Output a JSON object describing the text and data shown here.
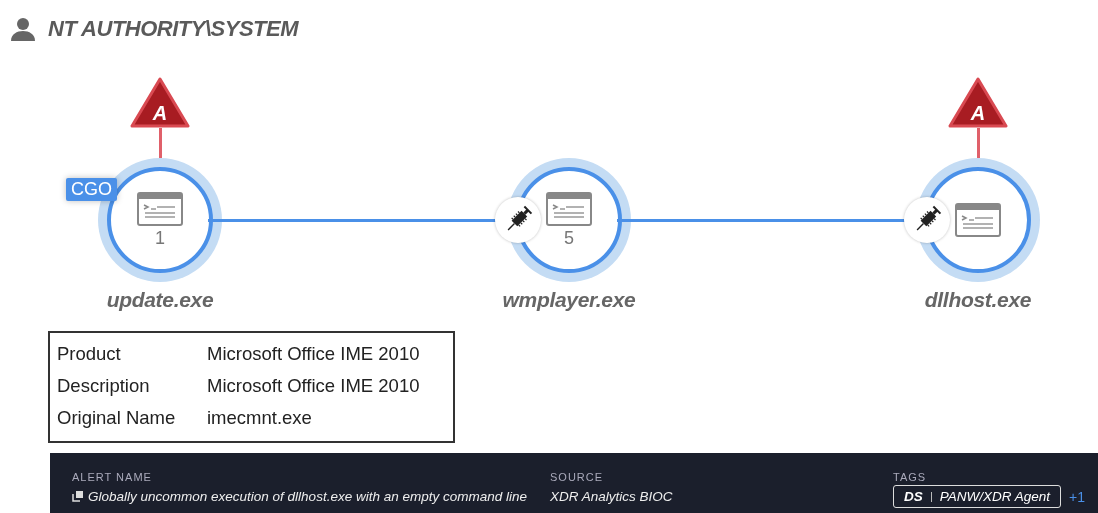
{
  "user": {
    "name": "NT AUTHORITY\\SYSTEM"
  },
  "nodes": [
    {
      "name": "update.exe",
      "count": "1",
      "alert": "A",
      "tag": "CGO",
      "injected": false
    },
    {
      "name": "wmplayer.exe",
      "count": "5",
      "injected": true
    },
    {
      "name": "dllhost.exe",
      "alert": "A",
      "injected": true
    }
  ],
  "details": [
    {
      "label": "Product",
      "value": "Microsoft Office IME 2010"
    },
    {
      "label": "Description",
      "value": "Microsoft Office IME 2010"
    },
    {
      "label": "Original Name",
      "value": "imecmnt.exe"
    }
  ],
  "alert": {
    "name_label": "ALERT NAME",
    "name": "Globally uncommon execution of dllhost.exe with an empty command line",
    "source_label": "SOURCE",
    "source": "XDR Analytics BIOC",
    "tags_label": "TAGS",
    "tag": {
      "prefix": "DS",
      "value": "PANW/XDR Agent"
    },
    "more": "+1"
  }
}
